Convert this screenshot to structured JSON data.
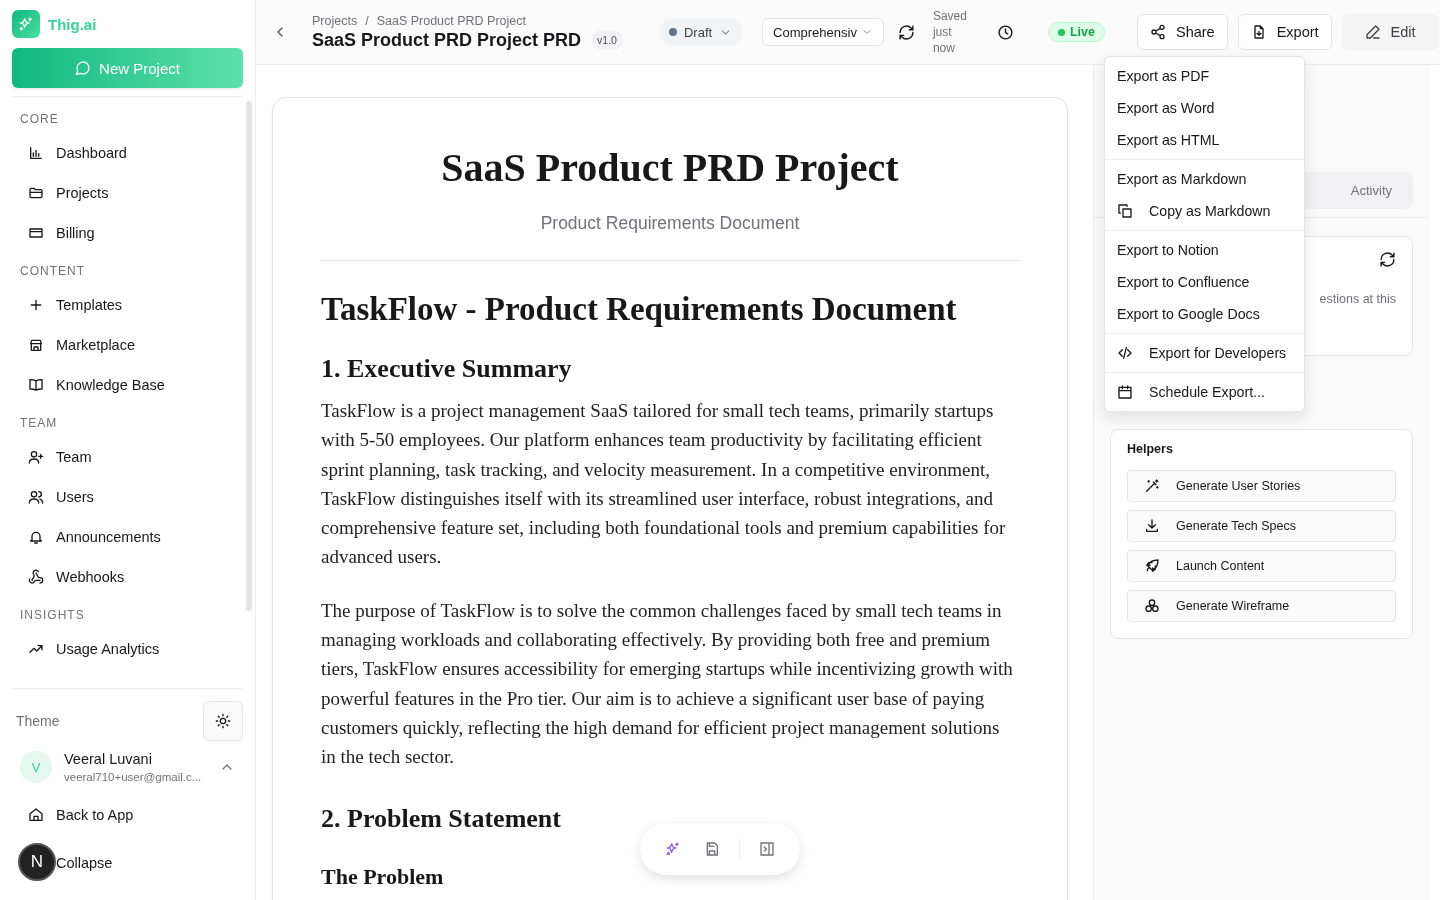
{
  "app": {
    "name": "Thig.ai"
  },
  "new_project_button": "New Project",
  "sidebar": {
    "sections": [
      {
        "title": "CORE",
        "items": [
          "Dashboard",
          "Projects",
          "Billing"
        ]
      },
      {
        "title": "CONTENT",
        "items": [
          "Templates",
          "Marketplace",
          "Knowledge Base"
        ]
      },
      {
        "title": "TEAM",
        "items": [
          "Team",
          "Users",
          "Announcements",
          "Webhooks"
        ]
      },
      {
        "title": "INSIGHTS",
        "items": [
          "Usage Analytics"
        ]
      }
    ]
  },
  "sidebar_footer": {
    "theme_label": "Theme",
    "user": {
      "initial": "V",
      "name": "Veeral Luvani",
      "email": "veeral710+user@gmail.c..."
    },
    "links": [
      "Back to App",
      "Collapse"
    ]
  },
  "dev_badge": "N",
  "header": {
    "breadcrumb": [
      "Projects",
      "SaaS Product PRD Project"
    ],
    "breadcrumb_separator": "/",
    "title": "SaaS Product PRD Project PRD",
    "version": "v1.0",
    "status": "Draft",
    "mode": "Comprehensiv",
    "save_status": "Saved just now",
    "live": "Live",
    "buttons": [
      "Share",
      "Export",
      "Edit"
    ]
  },
  "document": {
    "title": "SaaS Product PRD Project",
    "subtitle": "Product Requirements Document",
    "blocks": [
      {
        "kind": "h1",
        "text": "TaskFlow - Product Requirements Document"
      },
      {
        "kind": "h2",
        "text": "1. Executive Summary"
      },
      {
        "kind": "p",
        "text": "TaskFlow is a project management SaaS tailored for small tech teams, primarily startups with 5-50 employees. Our platform enhances team productivity by facilitating efficient sprint planning, task tracking, and velocity measurement. In a competitive environment, TaskFlow distinguishes itself with its streamlined user interface, robust integrations, and comprehensive feature set, including both foundational tools and premium capabilities for advanced users."
      },
      {
        "kind": "p",
        "text": "The purpose of TaskFlow is to solve the common challenges faced by small tech teams in managing workloads and collaborating effectively. By providing both free and premium tiers, TaskFlow ensures accessibility for emerging startups while incentivizing growth with powerful features in the Pro tier. Our aim is to achieve a significant user base of paying customers quickly, reflecting the high demand for efficient project management solutions in the tech sector."
      },
      {
        "kind": "h2",
        "text": "2. Problem Statement"
      },
      {
        "kind": "h3",
        "text": "The Problem"
      }
    ]
  },
  "right_panel": {
    "tabs": [
      {
        "label": "Activity",
        "selected": false
      }
    ],
    "card_text": "estions at this",
    "helpers": {
      "title": "Helpers",
      "items": [
        "Generate User Stories",
        "Generate Tech Specs",
        "Launch Content",
        "Generate Wireframe"
      ]
    }
  },
  "export_menu": {
    "groups": [
      [
        {
          "label": "Export as PDF",
          "kind": "plain"
        },
        {
          "label": "Export as Word",
          "kind": "plain"
        },
        {
          "label": "Export as HTML",
          "kind": "plain"
        }
      ],
      [
        {
          "label": "Export as Markdown",
          "kind": "plain"
        },
        {
          "label": "Copy as Markdown",
          "kind": "icon"
        }
      ],
      [
        {
          "label": "Export to Notion",
          "kind": "plain"
        },
        {
          "label": "Export to Confluence",
          "kind": "plain"
        },
        {
          "label": "Export to Google Docs",
          "kind": "plain"
        }
      ],
      [
        {
          "label": "Export for Developers",
          "kind": "icon"
        }
      ],
      [
        {
          "label": "Schedule Export...",
          "kind": "icon"
        }
      ]
    ]
  }
}
